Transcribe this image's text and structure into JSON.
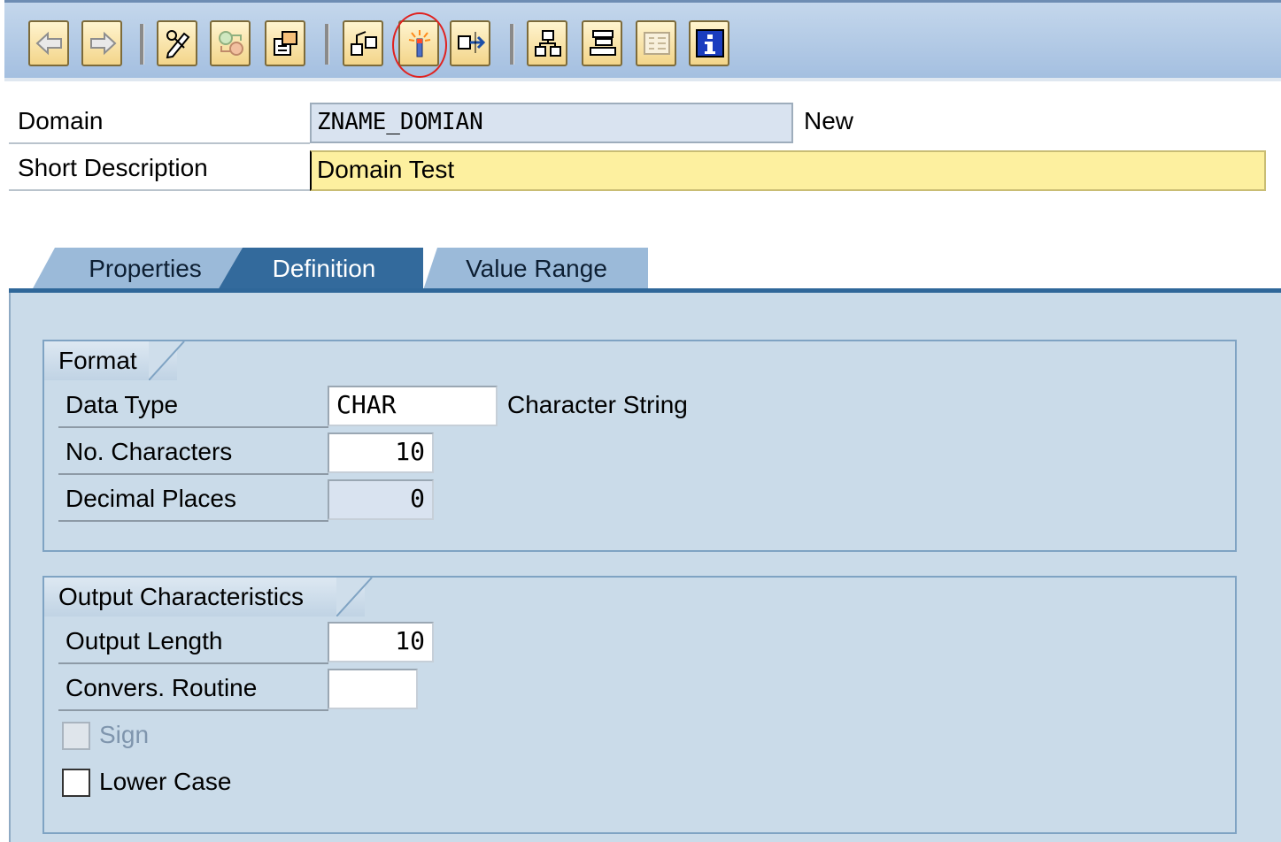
{
  "toolbar": {
    "buttons": [
      {
        "name": "back-icon"
      },
      {
        "name": "forward-icon"
      },
      {
        "name": "display-change-icon"
      },
      {
        "name": "active-inactive-icon"
      },
      {
        "name": "other-object-icon"
      },
      {
        "name": "check-icon"
      },
      {
        "name": "activate-icon"
      },
      {
        "name": "where-used-icon"
      },
      {
        "name": "object-list-icon"
      },
      {
        "name": "navigation-window-icon"
      },
      {
        "name": "display-object-list-icon"
      },
      {
        "name": "info-icon"
      }
    ],
    "highlight_color": "#e0221f"
  },
  "header": {
    "domain_label": "Domain",
    "domain_value": "ZNAME_DOMIAN",
    "domain_status": "New",
    "short_desc_label": "Short Description",
    "short_desc_value": "Domain Test"
  },
  "tabs": [
    {
      "label": "Properties",
      "active": false
    },
    {
      "label": "Definition",
      "active": true
    },
    {
      "label": "Value Range",
      "active": false
    }
  ],
  "format_group": {
    "title": "Format",
    "data_type_label": "Data Type",
    "data_type_value": "CHAR",
    "data_type_desc": "Character String",
    "num_chars_label": "No. Characters",
    "num_chars_value": "10",
    "decimals_label": "Decimal Places",
    "decimals_value": "0"
  },
  "output_group": {
    "title": "Output Characteristics",
    "output_length_label": "Output Length",
    "output_length_value": "10",
    "convers_label": "Convers. Routine",
    "convers_value": "",
    "sign_label": "Sign",
    "sign_checked": false,
    "sign_enabled": false,
    "lower_case_label": "Lower Case",
    "lower_case_checked": false
  },
  "colors": {
    "toolbar_bg": "#a4bfe0",
    "panel_bg": "#cadbe9",
    "active_tab": "#336a9c",
    "required_field": "#fdf09f"
  }
}
